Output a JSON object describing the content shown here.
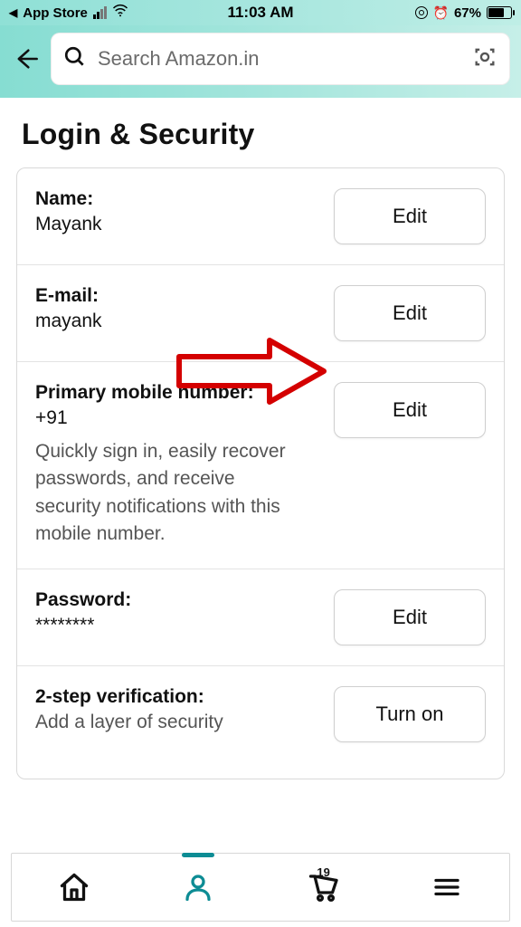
{
  "status": {
    "back_app": "App Store",
    "time": "11:03 AM",
    "battery_pct": "67%"
  },
  "header": {
    "search_placeholder": "Search Amazon.in"
  },
  "page": {
    "title": "Login & Security"
  },
  "rows": {
    "name": {
      "label": "Name:",
      "value": "Mayank",
      "button": "Edit"
    },
    "email": {
      "label": "E-mail:",
      "value": "mayank",
      "button": "Edit"
    },
    "phone": {
      "label": "Primary mobile number:",
      "value": "+91",
      "desc": "Quickly sign in, easily recover passwords, and receive security notifications with this mobile number.",
      "button": "Edit"
    },
    "password": {
      "label": "Password:",
      "value": "********",
      "button": "Edit"
    },
    "twostep": {
      "label": "2-step verification:",
      "value": "Add a layer of security",
      "button": "Turn on"
    }
  },
  "nav": {
    "cart_count": "19"
  }
}
